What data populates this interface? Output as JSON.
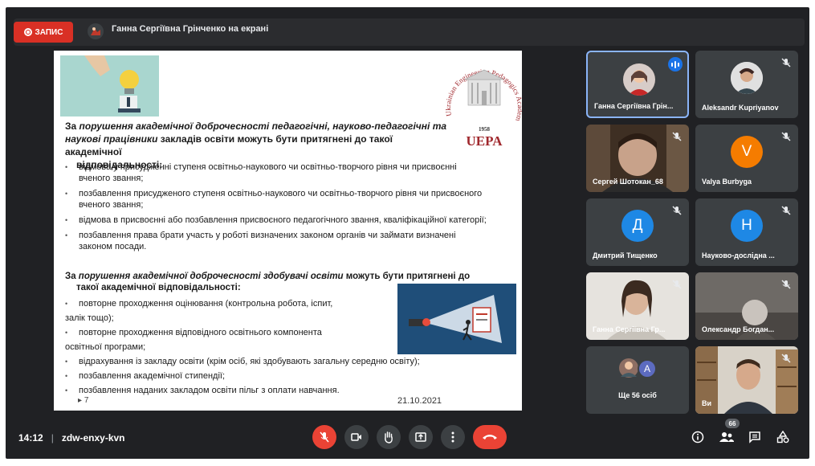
{
  "top_bar": {
    "record_label": "ЗАПИС",
    "presenting_text": "Ганна Сергіївна Грінченко на екрані"
  },
  "slide": {
    "logo": {
      "arc_text": "Ukrainian Engineering Pedagogics Academy",
      "year": "1958",
      "abbr": "UEPA"
    },
    "para1": {
      "lead": "За",
      "italic": "порушення академічної доброчесності педагогічні,  науково-педагогічні та наукові працівники",
      "rest": " закладів освіти  можуть бути притягнені до такої академічної",
      "line2": "відповідальності:"
    },
    "bullets1": [
      "відмова у присудженні ступеня освітньо-наукового чи освітньо-творчого рівня чи присвоєнні вченого звання;",
      "позбавлення присудженого ступеня освітньо-наукового чи освітньо-творчого рівня чи присвоєного вченого звання;",
      "відмова в присвоєнні або позбавлення присвоєного педагогічного звання, кваліфікаційної категорії;",
      "позбавлення права брати участь у роботі визначених законом органів чи займати визначені законом посади."
    ],
    "para2": {
      "lead": "За ",
      "italic": "порушення академічної доброчесності здобувачі освіти",
      "rest": " можуть бути притягнені до",
      "line2": "такої академічної відповідальності:"
    },
    "bullets2": {
      "b1": "повторне проходження оцінювання (контрольна робота, іспит,",
      "b1_cont": "залік тощо);",
      "b2": "повторне проходження відповідного освітнього компонента",
      "b2_cont": "освітньої програми;",
      "b3": "відрахування із закладу освіти (крім осіб, які здобувають загальну середню освіту);",
      "b4": "позбавлення академічної стипендії;",
      "b5": "позбавлення наданих закладом освіти пільг з оплати навчання."
    },
    "page_number": "7",
    "date": "21.10.2021"
  },
  "participants": [
    {
      "name": "Ганна Сергіївна Грін...",
      "type": "photo",
      "speaking": true
    },
    {
      "name": "Aleksandr Kupriyanov",
      "type": "photo",
      "muted": true
    },
    {
      "name": "Сергей Шотокан_68",
      "type": "video",
      "muted": true
    },
    {
      "name": "Valya Burbyga",
      "type": "letter",
      "letter": "V",
      "color": "#f57c00",
      "muted": true
    },
    {
      "name": "Дмитрий Тищенко",
      "type": "letter",
      "letter": "Д",
      "color": "#1e88e5",
      "muted": true
    },
    {
      "name": "Науково-дослідна ...",
      "type": "letter",
      "letter": "Н",
      "color": "#1e88e5",
      "muted": true
    },
    {
      "name": "Ганна Сергіївна Гр...",
      "type": "video",
      "muted": true
    },
    {
      "name": "Олександр Богдан...",
      "type": "video",
      "muted": true
    },
    {
      "name": "Ще 56 осіб",
      "type": "more",
      "letter": "A",
      "color": "#5c6bc0"
    },
    {
      "name": "Ви",
      "type": "video",
      "muted": true
    }
  ],
  "bottom_bar": {
    "time": "14:12",
    "separator": "|",
    "meeting_code": "zdw-enxy-kvn",
    "people_count": "66"
  },
  "colors": {
    "accent_red": "#ea4335",
    "active_border": "#8ab4f8",
    "logo_red": "#a0282d"
  }
}
